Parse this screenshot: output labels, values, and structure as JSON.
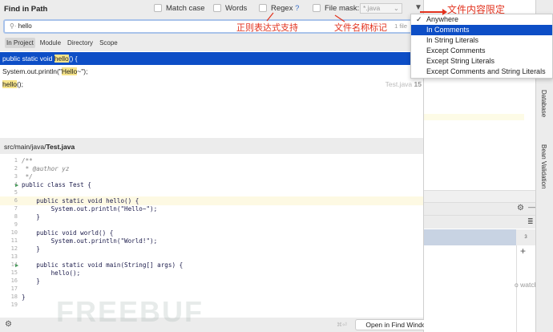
{
  "dialog": {
    "title": "Find in Path",
    "options": {
      "match_case": "Match case",
      "words": "Words",
      "regex": "Regex",
      "regex_help": "?",
      "file_mask": "File mask:",
      "file_mask_value": "*.java"
    },
    "search": {
      "value": "hello",
      "file_count": "1 file"
    },
    "scopes": [
      "In Project",
      "Module",
      "Directory",
      "Scope"
    ],
    "results": [
      {
        "pre": "public static void ",
        "match": "hello",
        "post": "() {"
      },
      {
        "pre": "System.out.println(\"",
        "match": "Hello",
        "post": "~\");"
      },
      {
        "pre": "",
        "match": "hello",
        "post": "();",
        "file": "Test.java",
        "line": "15"
      }
    ],
    "preview": {
      "path_prefix": "src/main/java/",
      "file": "Test.java"
    },
    "footer": {
      "shortcut": "⌘⏎",
      "open_button": "Open in Find Window"
    }
  },
  "menu": {
    "items": [
      "Anywhere",
      "In Comments",
      "In String Literals",
      "Except Comments",
      "Except String Literals",
      "Except Comments and String Literals"
    ],
    "checked": 0,
    "highlighted": 1
  },
  "annotations": {
    "regex": "正则表达式支持",
    "file_mask": "文件名称标记",
    "content": "文件内容限定"
  },
  "side": {
    "database": "Database",
    "bean": "Bean Validation",
    "watch": "o watch",
    "count": "3"
  },
  "watermark": "FREEBUF",
  "code": [
    "/**",
    " * @author yz",
    " */",
    "public class Test {",
    "",
    "    public static void hello() {",
    "        System.out.println(\"Hello~\");",
    "    }",
    "",
    "    public void world() {",
    "        System.out.println(\"World!\");",
    "    }",
    "",
    "    public static void main(String[] args) {",
    "        hello();",
    "    }",
    "",
    "}",
    ""
  ]
}
